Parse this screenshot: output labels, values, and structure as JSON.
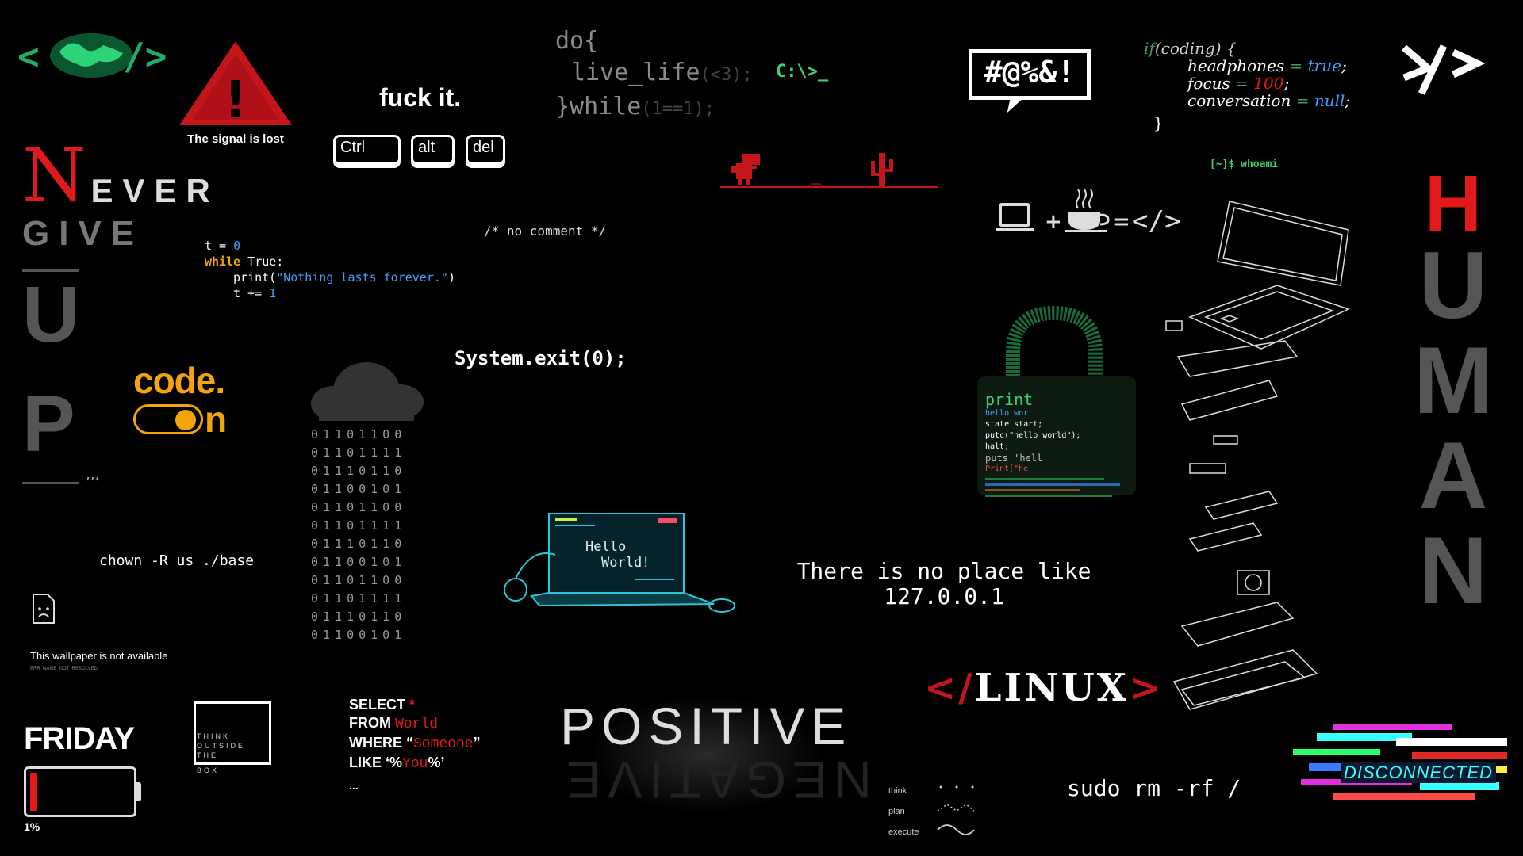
{
  "signal": {
    "text": "The signal is lost",
    "symbol": "!"
  },
  "fuck_it": "fuck it.",
  "keys": [
    "Ctrl",
    "alt",
    "del"
  ],
  "do_while": {
    "line1": "do{",
    "line2": "live_life",
    "line2_arg": "(<3);",
    "line3a": "}while",
    "line3b": "(1==1);"
  },
  "prompt_cd": "C:\\>_",
  "swear": "#@%&!",
  "if_coding": {
    "l1_kw": "if",
    "l1_rest": "(coding) {",
    "l2_name": "headphones",
    "l2_eq": " = ",
    "l2_val": "true",
    "l2_end": ";",
    "l3_name": "focus",
    "l3_eq": " = ",
    "l3_val": "100",
    "l3_end": ";",
    "l4_name": "conversation",
    "l4_eq": " = ",
    "l4_val": "null",
    "l4_end": ";",
    "l5": "}"
  },
  "code_mark": "</>",
  "whoami": "[~]$ whoami",
  "never": {
    "n": "N",
    "ever": "EVER",
    "give": "GIVE",
    "u": "U",
    "p": "P",
    "tick": "’’’"
  },
  "python": {
    "l1_var": "t",
    "l1_eq": " = ",
    "l1_val": "0",
    "l2_kw": "while",
    "l2_rest": " True:",
    "l3_fn": "print(",
    "l3_str": "\"Nothing lasts forever.\"",
    "l3_end": ")",
    "l4_var": "t",
    "l4_op": " += ",
    "l4_val": "1"
  },
  "no_comment": "/* no comment */",
  "equation": {
    "plus": "+",
    "eq": "=",
    "result": "</>"
  },
  "code_on": {
    "code": "code.",
    "on": "n"
  },
  "binary": [
    "01101100",
    "01101111",
    "01110110",
    "01100101",
    "01101100",
    "01101111",
    "01110110",
    "01100101",
    "01101100",
    "01101111",
    "01110110",
    "01100101"
  ],
  "system_exit": "System.exit(0);",
  "hello_world_screen": {
    "line1": "Hello",
    "line2": "World!"
  },
  "localhost": {
    "line1": "There is no place like",
    "line2": "127.0.0.1"
  },
  "chown": "chown -R us ./base",
  "unavailable": {
    "text": "This wallpaper is not available",
    "code": "ERR_NAME_NOT_RESOLVED"
  },
  "friday": {
    "text": "FRIDAY",
    "battery": "1%",
    "battery_level": 0.01
  },
  "think_box": {
    "l1": "THINK",
    "l2": "OUTSIDE",
    "l3": "THE",
    "l4": "BOX"
  },
  "sql": {
    "l1_kw": "SELECT ",
    "l1_val": "*",
    "l2_kw": "FROM ",
    "l2_val": "World",
    "l3_kw": "WHERE ",
    "l3_q1": "“",
    "l3_val": "Someone",
    "l3_q2": "”",
    "l4_kw": "LIKE ",
    "l4_q1": "‘%",
    "l4_val": "You",
    "l4_q2": "%’",
    "l5": "..."
  },
  "positive": {
    "top": "POSITIVE",
    "bottom": "NEGATIVE"
  },
  "linux": {
    "open": "</",
    "word": "LINUX",
    "close": ">"
  },
  "plan": {
    "think": "think",
    "plan": "plan",
    "execute": "execute"
  },
  "sudo": "sudo rm -rf /",
  "disconnected": "DISCONNECTED",
  "human": {
    "h": "H",
    "letters": [
      "U",
      "M",
      "A",
      "N"
    ]
  },
  "lock_code": [
    "print",
    "hello wor",
    "state start;",
    "putc(\"hello world\");",
    "halt;",
    "puts 'hell",
    "Print[\"he"
  ]
}
